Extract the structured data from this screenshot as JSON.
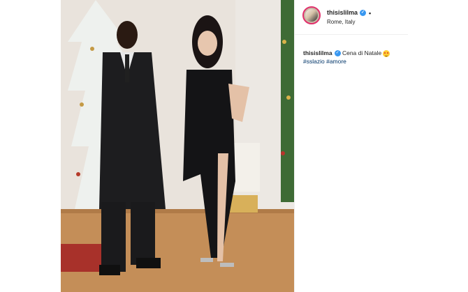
{
  "post": {
    "username": "thisislilma",
    "location": "Rome, Italy",
    "caption_username": "thisislilma",
    "caption_text": "Cena di Natale",
    "caption_emoji": "smiling-face-with-heart-eyes-emoji",
    "hashtags": [
      "#sslazio",
      "#amore"
    ]
  },
  "colors": {
    "verified_blue": "#3897f0",
    "hashtag_blue": "#003569",
    "text_dark": "#262626"
  },
  "icons": {
    "verified": "verified-badge-icon",
    "more": "dot-icon"
  }
}
